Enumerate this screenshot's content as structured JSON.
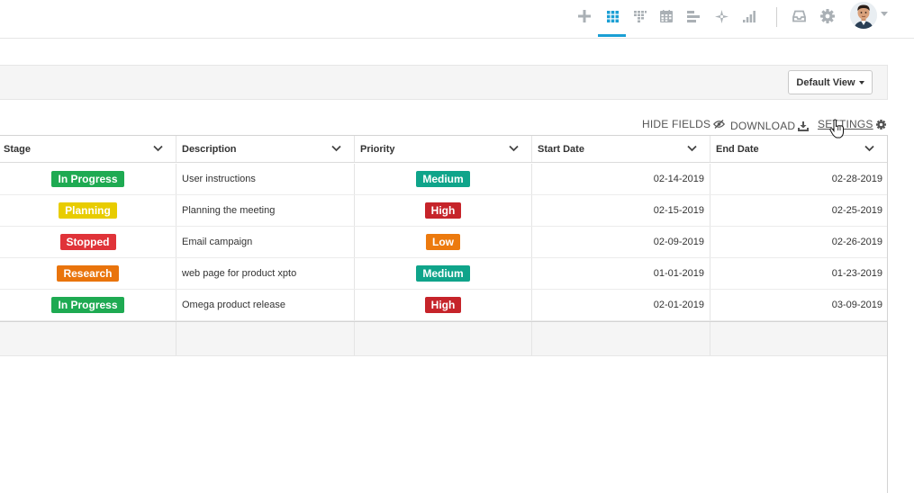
{
  "header": {
    "icons": [
      {
        "name": "add-icon"
      },
      {
        "name": "grid-view-icon",
        "active": true
      },
      {
        "name": "kanban-view-icon"
      },
      {
        "name": "calendar-view-icon"
      },
      {
        "name": "gantt-view-icon"
      },
      {
        "name": "map-view-icon"
      },
      {
        "name": "chart-view-icon"
      },
      {
        "name": "inbox-icon"
      },
      {
        "name": "gear-icon"
      }
    ],
    "active_color": "#1b9fd4"
  },
  "toolbar": {
    "view_label": "Default View"
  },
  "actions": {
    "hide_fields": "HIDE FIELDS",
    "download": "DOWNLOAD",
    "settings": "SETTINGS"
  },
  "table": {
    "columns": [
      "Stage",
      "Description",
      "Priority",
      "Start Date",
      "End Date"
    ],
    "rows": [
      {
        "stage": "In Progress",
        "stage_color": "#1eaa52",
        "description": "User instructions",
        "priority": "Medium",
        "priority_color": "#0fa48a",
        "start": "02-14-2019",
        "end": "02-28-2019"
      },
      {
        "stage": "Planning",
        "stage_color": "#e8cc00",
        "description": "Planning the meeting",
        "priority": "High",
        "priority_color": "#c6242a",
        "start": "02-15-2019",
        "end": "02-25-2019"
      },
      {
        "stage": "Stopped",
        "stage_color": "#e03339",
        "description": "Email campaign",
        "priority": "Low",
        "priority_color": "#ec7a0e",
        "start": "02-09-2019",
        "end": "02-26-2019"
      },
      {
        "stage": "Research",
        "stage_color": "#e9740c",
        "description": "web page for product xpto",
        "priority": "Medium",
        "priority_color": "#0fa48a",
        "start": "01-01-2019",
        "end": "01-23-2019"
      },
      {
        "stage": "In Progress",
        "stage_color": "#1eaa52",
        "description": "Omega product release",
        "priority": "High",
        "priority_color": "#c6242a",
        "start": "02-01-2019",
        "end": "03-09-2019"
      }
    ]
  }
}
